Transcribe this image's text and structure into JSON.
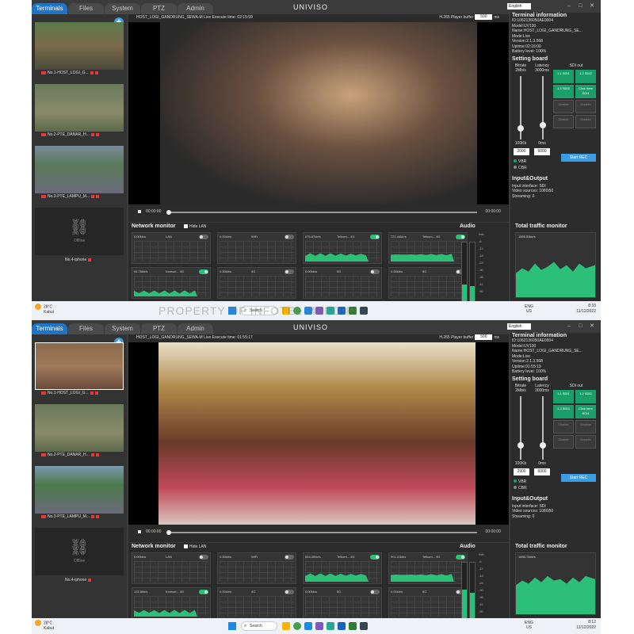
{
  "screens": [
    {
      "tabs": [
        "Terminals",
        "Files",
        "System",
        "PTZ",
        "Admin"
      ],
      "active_tab": "Terminals",
      "brand": "UNIVISO",
      "language": "English",
      "video_info": "HOST_LOGI_GANDRUNG_SEWA-M Live  Execute time: 02:15:59",
      "codec": "H.265",
      "player_buffer_label": "Player buffer",
      "player_buffer_value": "500",
      "buffer_unit": "ms",
      "time_left": "00:00:00",
      "time_right": "00:00:00",
      "terminals": [
        {
          "name": "No.1-HOST_LOGI_G..."
        },
        {
          "name": "No.2-PTE_DANAR_H..."
        },
        {
          "name": "No.3-PTE_LAMPU_M..."
        },
        {
          "name": "No.4-iphone",
          "status": "Offline"
        }
      ],
      "terminal_info": {
        "title": "Terminal information",
        "id": "ID:1062136050AE0004",
        "model": "Model:UV100",
        "name": "Name:HOST_LOGI_GANDRUNG_SE...",
        "mode": "Mode:Live",
        "version": "Version:2.1.3.568",
        "uptime": "Uptime:02:16:00",
        "battery": "Battery level: 100%"
      },
      "setting_board": {
        "title": "Setting board",
        "bitrate_label": "Bitrate 2Mb/s",
        "latency_label": "Latency 3000ms",
        "sdi_out_label": "SDI out",
        "sdi": [
          "1.1 SDI1",
          "1.2 SDI2",
          "1.3 SDI3",
          "Click here SDI4",
          "Disable",
          "Disable",
          "Disable",
          "Disable"
        ],
        "bitrate_unit": "100Kb",
        "latency_unit": "0ms",
        "bitrate_value": "2000",
        "latency_value": "6000",
        "vbr": "VBR",
        "cbr": "CBR",
        "start_btn": "Start REC"
      },
      "input_output": {
        "title": "Input&Output",
        "input": "Input interface: SDI",
        "video_sources": "Video sources: 1080i50",
        "streaming": "Streaming: 0"
      },
      "network_monitor": {
        "title": "Network monitor",
        "hide_lan": "Hide LAN",
        "cards": [
          {
            "rate": "0.00kb/s",
            "name": "LAN",
            "on": false,
            "level": 0
          },
          {
            "rate": "0.00kb/s",
            "name": "WiFi",
            "on": false,
            "level": 0
          },
          {
            "rate": "675.87kb/s",
            "name": "Telkom... 4G",
            "on": true,
            "level": 0.55
          },
          {
            "rate": "721.44kb/s",
            "name": "Telkom... 4G",
            "on": true,
            "level": 0.55
          },
          {
            "rate": "94.76kb/s",
            "name": "Komsel... 4G",
            "on": true,
            "level": 0.35
          },
          {
            "rate": "0.00kb/s",
            "name": "4G",
            "on": false,
            "level": 0
          },
          {
            "rate": "0.00kb/s",
            "name": "5G",
            "on": false,
            "level": 0
          },
          {
            "rate": "0.00kb/s",
            "name": "5G",
            "on": false,
            "level": 0
          }
        ]
      },
      "audio": {
        "title": "Audio",
        "scale": [
          "0db",
          "-6",
          "-12",
          "-18",
          "-24",
          "-30",
          "-36",
          "-42",
          "-50"
        ],
        "left_level": 0.3,
        "right_level": 0.28
      },
      "traffic": {
        "title": "Total traffic monitor",
        "value": "1565.53kb/s"
      },
      "taskbar": {
        "temp": "28°C",
        "weather": "Kabut",
        "search": "Search",
        "lang": "ENG",
        "region": "US",
        "time": "8:33",
        "date": "11/12/2022"
      }
    },
    {
      "tabs": [
        "Terminals",
        "Files",
        "System",
        "PTZ",
        "Admin"
      ],
      "active_tab": "Terminals",
      "brand": "UNIVISO",
      "language": "English",
      "video_info": "HOST_LOGI_GANDRUNG_SEWA-M Live  Execute time: 01:55:17",
      "codec": "H.265",
      "player_buffer_label": "Player buffer",
      "player_buffer_value": "500",
      "buffer_unit": "ms",
      "time_left": "00:00:00",
      "time_right": "00:00:00",
      "terminals": [
        {
          "name": "No.1-HOST_LOGI_G..."
        },
        {
          "name": "No.2-PTE_DANAR_H..."
        },
        {
          "name": "No.3-PTE_LAMPU_M..."
        },
        {
          "name": "No.4-iphone",
          "status": "Offline"
        }
      ],
      "terminal_info": {
        "title": "Terminal information",
        "id": "ID:1062136050AE0004",
        "model": "Model:UV100",
        "name": "Name:HOST_LOGI_GANDRUNG_SE...",
        "mode": "Mode:Live",
        "version": "Version:2.1.3.568",
        "uptime": "Uptime:01:55:19",
        "battery": "Battery level: 100%"
      },
      "setting_board": {
        "title": "Setting board",
        "bitrate_label": "Bitrate 2Mb/s",
        "latency_label": "Latency 3000ms",
        "sdi_out_label": "SDI out",
        "sdi": [
          "1.1 SDI1",
          "1.2 SDI2",
          "1.3 SDI3",
          "Click here SDI4",
          "Disable",
          "Disable",
          "Disable",
          "Disable"
        ],
        "bitrate_unit": "100Kb",
        "latency_unit": "0ms",
        "bitrate_value": "2900",
        "latency_value": "6000",
        "vbr": "VBR",
        "cbr": "CBR",
        "start_btn": "Start REC"
      },
      "input_output": {
        "title": "Input&Output",
        "input": "Input interface: SDI",
        "video_sources": "Video sources: 1080i50",
        "streaming": "Streaming: 0"
      },
      "network_monitor": {
        "title": "Network monitor",
        "hide_lan": "Hide LAN",
        "cards": [
          {
            "rate": "0.00kb/s",
            "name": "LAN",
            "on": false,
            "level": 0
          },
          {
            "rate": "0.00kb/s",
            "name": "WiFi",
            "on": false,
            "level": 0
          },
          {
            "rate": "864.46kb/s",
            "name": "Telkom... 4G",
            "on": true,
            "level": 0.55
          },
          {
            "rate": "901.11kb/s",
            "name": "Telkom... 4G",
            "on": true,
            "level": 0.55
          },
          {
            "rate": "132.8kb/s",
            "name": "Komsel... 4G",
            "on": true,
            "level": 0.4
          },
          {
            "rate": "0.00kb/s",
            "name": "4G",
            "on": false,
            "level": 0
          },
          {
            "rate": "0.00kb/s",
            "name": "5G",
            "on": false,
            "level": 0
          },
          {
            "rate": "0.00kb/s",
            "name": "5G",
            "on": false,
            "level": 0
          }
        ]
      },
      "audio": {
        "title": "Audio",
        "scale": [
          "0db",
          "-6",
          "-12",
          "-18",
          "-24",
          "-30",
          "-36",
          "-42",
          "-50"
        ],
        "left_level": 0.55,
        "right_level": 0.5
      },
      "traffic": {
        "title": "Total traffic monitor",
        "value": "1898.76kb/s"
      },
      "taskbar": {
        "temp": "28°C",
        "weather": "Kabut",
        "search": "Search",
        "lang": "ENG",
        "region": "US",
        "time": "8:12",
        "date": "11/12/2022"
      }
    }
  ],
  "watermark": "PROPERTY OF INFOTEL MANDIRI"
}
